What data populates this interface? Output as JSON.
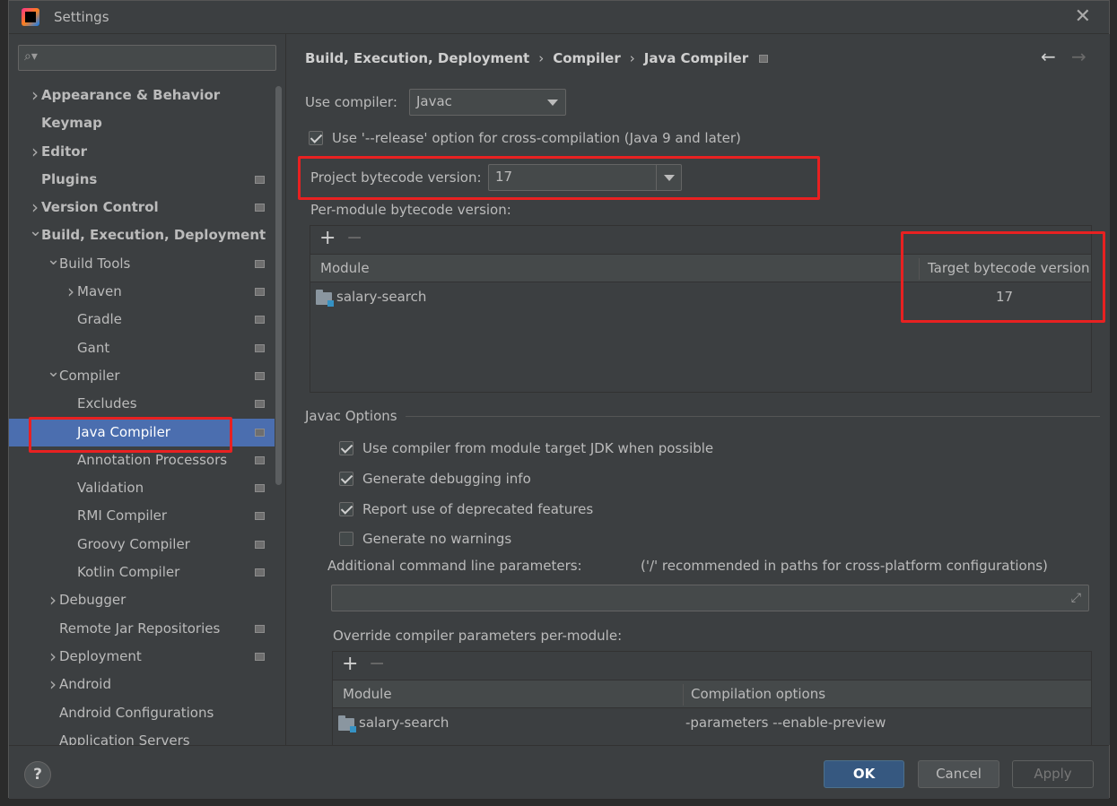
{
  "window": {
    "title": "Settings"
  },
  "search": {
    "placeholder": ""
  },
  "sidebar": {
    "items": [
      {
        "label": "Appearance & Behavior",
        "level": 0,
        "arrow": "right",
        "bold": true,
        "proj": false
      },
      {
        "label": "Keymap",
        "level": 0,
        "arrow": "",
        "bold": true,
        "proj": false
      },
      {
        "label": "Editor",
        "level": 0,
        "arrow": "right",
        "bold": true,
        "proj": false
      },
      {
        "label": "Plugins",
        "level": 0,
        "arrow": "",
        "bold": true,
        "proj": true
      },
      {
        "label": "Version Control",
        "level": 0,
        "arrow": "right",
        "bold": true,
        "proj": true
      },
      {
        "label": "Build, Execution, Deployment",
        "level": 0,
        "arrow": "down",
        "bold": true,
        "proj": false
      },
      {
        "label": "Build Tools",
        "level": 1,
        "arrow": "down",
        "bold": false,
        "proj": true
      },
      {
        "label": "Maven",
        "level": 2,
        "arrow": "right",
        "bold": false,
        "proj": true
      },
      {
        "label": "Gradle",
        "level": 2,
        "arrow": "",
        "bold": false,
        "proj": true
      },
      {
        "label": "Gant",
        "level": 2,
        "arrow": "",
        "bold": false,
        "proj": true
      },
      {
        "label": "Compiler",
        "level": 1,
        "arrow": "down",
        "bold": false,
        "proj": true
      },
      {
        "label": "Excludes",
        "level": 2,
        "arrow": "",
        "bold": false,
        "proj": true
      },
      {
        "label": "Java Compiler",
        "level": 2,
        "arrow": "",
        "bold": false,
        "proj": true,
        "selected": true
      },
      {
        "label": "Annotation Processors",
        "level": 2,
        "arrow": "",
        "bold": false,
        "proj": true
      },
      {
        "label": "Validation",
        "level": 2,
        "arrow": "",
        "bold": false,
        "proj": true
      },
      {
        "label": "RMI Compiler",
        "level": 2,
        "arrow": "",
        "bold": false,
        "proj": true
      },
      {
        "label": "Groovy Compiler",
        "level": 2,
        "arrow": "",
        "bold": false,
        "proj": true
      },
      {
        "label": "Kotlin Compiler",
        "level": 2,
        "arrow": "",
        "bold": false,
        "proj": true
      },
      {
        "label": "Debugger",
        "level": 1,
        "arrow": "right",
        "bold": false,
        "proj": false
      },
      {
        "label": "Remote Jar Repositories",
        "level": 1,
        "arrow": "",
        "bold": false,
        "proj": true
      },
      {
        "label": "Deployment",
        "level": 1,
        "arrow": "right",
        "bold": false,
        "proj": true
      },
      {
        "label": "Android",
        "level": 1,
        "arrow": "right",
        "bold": false,
        "proj": false
      },
      {
        "label": "Android Configurations",
        "level": 1,
        "arrow": "",
        "bold": false,
        "proj": false
      },
      {
        "label": "Application Servers",
        "level": 1,
        "arrow": "",
        "bold": false,
        "proj": false
      }
    ]
  },
  "breadcrumb": {
    "part1": "Build, Execution, Deployment",
    "sep1": "›",
    "part2": "Compiler",
    "sep2": "›",
    "part3": "Java Compiler"
  },
  "nav": {
    "back": "←",
    "forward": "→"
  },
  "compiler": {
    "use_compiler_label": "Use compiler:",
    "use_compiler_value": "Javac",
    "release_option_label": "Use '--release' option for cross-compilation (Java 9 and later)",
    "release_option_checked": true,
    "project_bytecode_label": "Project bytecode version:",
    "project_bytecode_value": "17",
    "per_module_label": "Per-module bytecode version:"
  },
  "module_table": {
    "plus": "+",
    "minus": "−",
    "col_module": "Module",
    "col_target": "Target bytecode version",
    "rows": [
      {
        "module": "salary-search",
        "target": "17"
      }
    ]
  },
  "javac": {
    "section_title": "Javac Options",
    "opt1_label": "Use compiler from module target JDK when possible",
    "opt1_checked": true,
    "opt2_label": "Generate debugging info",
    "opt2_checked": true,
    "opt3_label": "Report use of deprecated features",
    "opt3_checked": true,
    "opt4_label": "Generate no warnings",
    "opt4_checked": false,
    "additional_params_label": "Additional command line parameters:",
    "additional_params_hint": "('/' recommended in paths for cross-platform configurations)",
    "additional_params_value": "",
    "override_label": "Override compiler parameters per-module:"
  },
  "override_table": {
    "plus": "+",
    "minus": "−",
    "col_module": "Module",
    "col_options": "Compilation options",
    "rows": [
      {
        "module": "salary-search",
        "options": "-parameters --enable-preview"
      }
    ]
  },
  "buttons": {
    "help": "?",
    "ok": "OK",
    "cancel": "Cancel",
    "apply": "Apply"
  },
  "colors": {
    "selection": "#4b6eaf",
    "highlight_box": "#e82121",
    "ok_button": "#365880"
  }
}
